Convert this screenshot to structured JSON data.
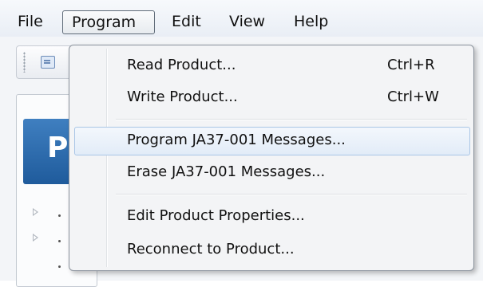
{
  "menubar": {
    "items": [
      "File",
      "Program",
      "Edit",
      "View",
      "Help"
    ]
  },
  "background": {
    "panel_header_letter": "P"
  },
  "program_menu": {
    "items": [
      {
        "label": "Read Product...",
        "shortcut": "Ctrl+R"
      },
      {
        "label": "Write Product...",
        "shortcut": "Ctrl+W"
      },
      {
        "label": "Program JA37-001 Messages...",
        "shortcut": "",
        "highlighted": true
      },
      {
        "label": "Erase JA37-001 Messages...",
        "shortcut": ""
      },
      {
        "label": "Edit Product Properties...",
        "shortcut": ""
      },
      {
        "label": "Reconnect to Product...",
        "shortcut": ""
      }
    ]
  },
  "colors": {
    "highlight_border": "#aac6e6",
    "panel_header_blue": "#2a6aad"
  }
}
